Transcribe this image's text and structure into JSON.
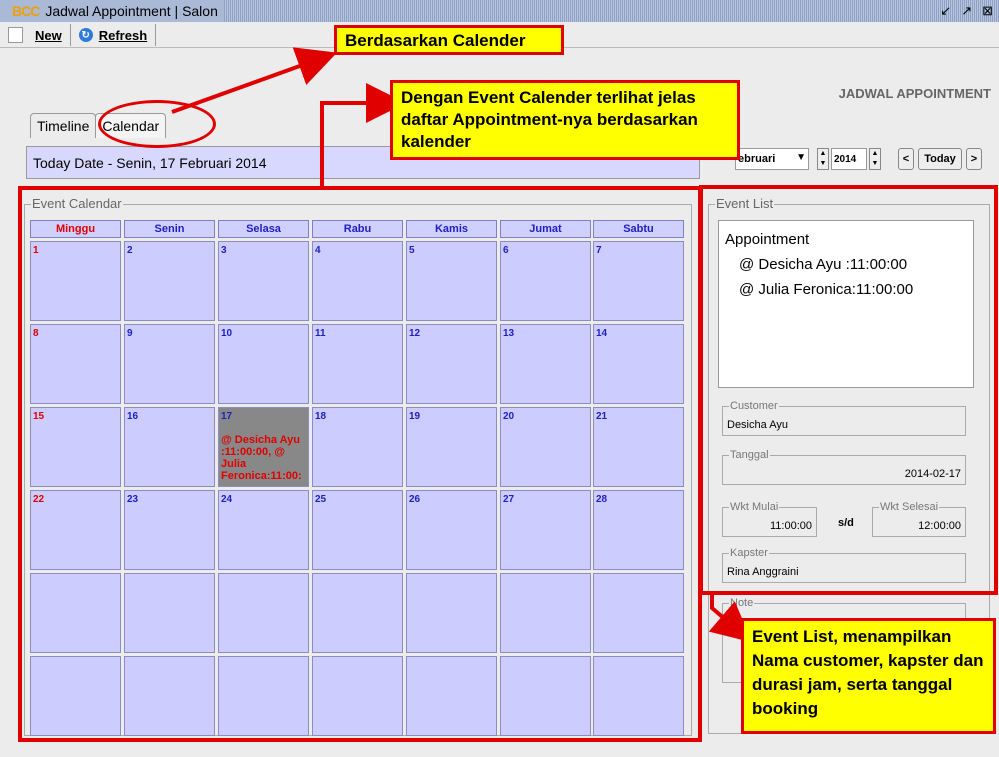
{
  "window": {
    "logo": "BCC",
    "title": "Jadwal Appointment | Salon",
    "controls": [
      "minimize-icon",
      "maximize-icon",
      "close-icon"
    ]
  },
  "toolbar": {
    "new_label": "New",
    "refresh_label": "Refresh"
  },
  "page": {
    "heading": "JADWAL APPOINTMENT",
    "tabs": [
      {
        "label": "Timeline"
      },
      {
        "label": "Calendar"
      }
    ],
    "today_text": "Today Date - Senin, 17 Februari 2014",
    "month": "ebruari",
    "year": "2014",
    "prev_label": "<",
    "today_label": "Today",
    "next_label": ">"
  },
  "calendar": {
    "legend": "Event Calendar",
    "days": [
      "Minggu",
      "Senin",
      "Selasa",
      "Rabu",
      "Kamis",
      "Jumat",
      "Sabtu"
    ],
    "weeks": [
      [
        "1",
        "2",
        "3",
        "4",
        "5",
        "6",
        "7"
      ],
      [
        "8",
        "9",
        "10",
        "11",
        "12",
        "13",
        "14"
      ],
      [
        "15",
        "16",
        "17",
        "18",
        "19",
        "20",
        "21"
      ],
      [
        "22",
        "23",
        "24",
        "25",
        "26",
        "27",
        "28"
      ],
      [
        "",
        "",
        "",
        "",
        "",
        "",
        ""
      ],
      [
        "",
        "",
        "",
        "",
        "",
        "",
        ""
      ]
    ],
    "today": "17",
    "today_event": "@ Desicha Ayu  :11:00:00, @ Julia Feronica:11:00:"
  },
  "event_list": {
    "legend": "Event List",
    "heading": "Appointment",
    "items": [
      "@ Desicha Ayu  :11:00:00",
      "@ Julia Feronica:11:00:00"
    ],
    "customer_label": "Customer",
    "customer": "Desicha Ayu",
    "tanggal_label": "Tanggal",
    "tanggal": "2014-02-17",
    "mulai_label": "Wkt Mulai",
    "mulai": "11:00:00",
    "sd": "s/d",
    "selesai_label": "Wkt Selesai",
    "selesai": "12:00:00",
    "kapster_label": "Kapster",
    "kapster": "Rina Anggraini",
    "note_label": "Note"
  },
  "annotations": {
    "a1": "Berdasarkan Calender",
    "a2": "Dengan Event Calender terlihat jelas daftar Appointment-nya berdasarkan kalender",
    "a3": "Event List, menampilkan Nama customer, kapster dan durasi jam, serta tanggal booking"
  },
  "colors": {
    "cell": "#ccccff",
    "today_cell": "#888888",
    "annotation_bg": "#ffff00",
    "annotation_border": "#e00000"
  }
}
